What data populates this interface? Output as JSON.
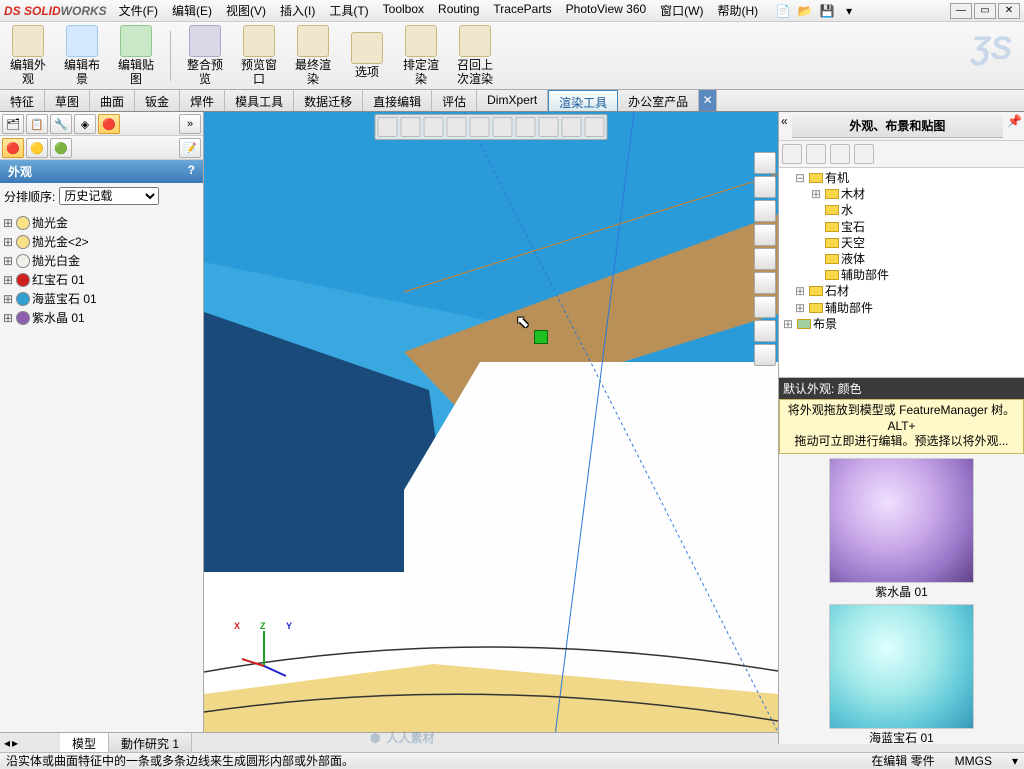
{
  "title": {
    "app": "SOLIDWORKS"
  },
  "menu": {
    "file": "文件(F)",
    "edit": "编辑(E)",
    "view": "视图(V)",
    "insert": "插入(I)",
    "tools": "工具(T)",
    "toolbox": "Toolbox",
    "routing": "Routing",
    "traceparts": "TraceParts",
    "photoview": "PhotoView 360",
    "window": "窗口(W)",
    "help": "帮助(H)"
  },
  "ribbon": {
    "b1": "编辑外观",
    "b2": "编辑布景",
    "b3": "编辑贴图",
    "b4": "整合预览",
    "b5": "预览窗口",
    "b6": "最终渲染",
    "b7": "选项",
    "b8": "排定渲染",
    "b9": "召回上次渲染"
  },
  "tabs": {
    "t1": "特征",
    "t2": "草图",
    "t3": "曲面",
    "t4": "钣金",
    "t5": "焊件",
    "t6": "模具工具",
    "t7": "数据迁移",
    "t8": "直接编辑",
    "t9": "评估",
    "t10": "DimXpert",
    "t11": "渲染工具",
    "t12": "办公室产品"
  },
  "left": {
    "header": "外观",
    "help": "?",
    "sort_label": "分排顺序:",
    "sort_value": "历史记载",
    "items": [
      {
        "label": "抛光金",
        "color": "#f8e088"
      },
      {
        "label": "抛光金<2>",
        "color": "#f8e088"
      },
      {
        "label": "抛光白金",
        "color": "#f0f0e8"
      },
      {
        "label": "红宝石 01",
        "color": "#d02020"
      },
      {
        "label": "海蓝宝石 01",
        "color": "#30a0d0"
      },
      {
        "label": "紫水晶 01",
        "color": "#9060b0"
      }
    ]
  },
  "right": {
    "title": "外观、布景和贴图",
    "tree": {
      "organic": "有机",
      "items": [
        "木材",
        "水",
        "宝石",
        "天空",
        "液体",
        "辅助部件"
      ],
      "stone": "石材",
      "aux": "辅助部件",
      "scene": "布景"
    },
    "hint_title": "默认外观: 颜色",
    "hint_body1": "将外观拖放到模型或 FeatureManager 树。ALT+",
    "hint_body2": "拖动可立即进行编辑。预选择以将外观...",
    "preview1": "紫水晶 01",
    "preview2": "海蓝宝石 01"
  },
  "bottom_tabs": {
    "model": "模型",
    "motion": "動作研究 1"
  },
  "status": {
    "msg": "沿实体或曲面特征中的一条或多条边线来生成圆形内部或外部面。",
    "edit": "在编辑  零件",
    "units": "MMGS"
  },
  "watermark": "人人素材"
}
